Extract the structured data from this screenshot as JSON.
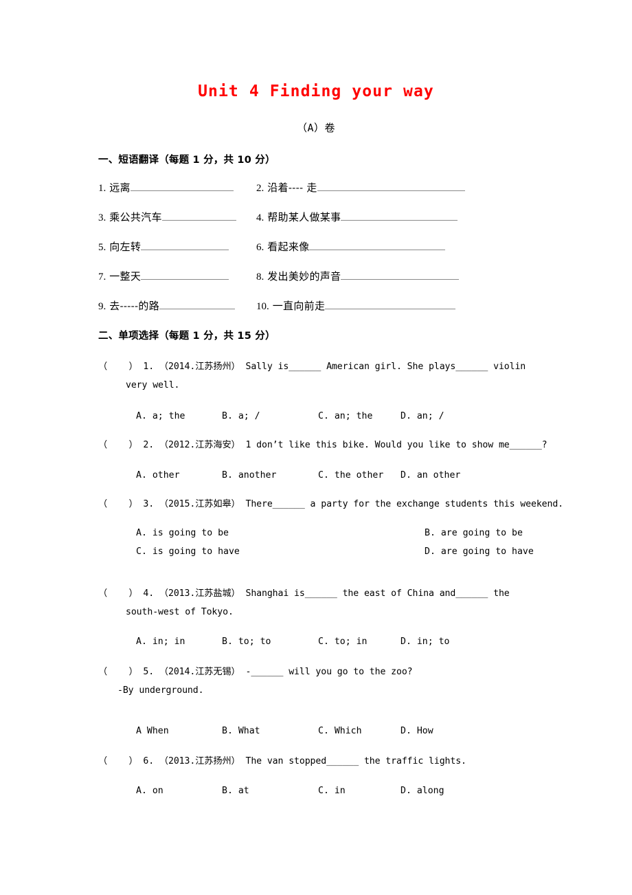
{
  "document": {
    "title": "Unit 4 Finding your way",
    "subtitle": "（A）卷"
  },
  "sections": [
    {
      "heading": "一、短语翻译（每题 1 分，共 10 分）",
      "type": "translation",
      "items": [
        {
          "num": "1.",
          "zh": "远离",
          "blank_width": 150
        },
        {
          "num": "2.",
          "zh": "沿着---- 走",
          "blank_width": 215
        },
        {
          "num": "3.",
          "zh": "乘公共汽车",
          "blank_width": 108
        },
        {
          "num": "4.",
          "zh": "帮助某人做某事",
          "blank_width": 170
        },
        {
          "num": "5.",
          "zh": "向左转",
          "blank_width": 128
        },
        {
          "num": "6.",
          "zh": "看起来像",
          "blank_width": 198
        },
        {
          "num": "7.",
          "zh": "一整天",
          "blank_width": 128
        },
        {
          "num": "8.",
          "zh": "发出美妙的声音",
          "blank_width": 172
        },
        {
          "num": "9.",
          "zh": "去-----的路",
          "blank_width": 110
        },
        {
          "num": "10.",
          "zh": "一直向前走",
          "blank_width": 190
        }
      ]
    },
    {
      "heading": "二、单项选择（每题 1 分，共 15 分）",
      "type": "multiple_choice",
      "questions": [
        {
          "marker": "（    ）",
          "num": "1.",
          "source": "（2014.江苏扬州）",
          "line1": "Sally is______ American girl. She plays______ violin",
          "line2": "very well.",
          "options": [
            "A. a; the",
            "B. a; /",
            "C. an; the",
            "D. an; /"
          ],
          "layout": "four-across"
        },
        {
          "marker": "（    ）",
          "num": "2.",
          "source": "（2012.江苏海安）",
          "line1": "1 don’t like this bike. Would you like to show me______?",
          "line2": "",
          "options": [
            "A. other",
            "B. another",
            "C. the other",
            "D. an other"
          ],
          "layout": "four-across"
        },
        {
          "marker": "（    ）",
          "num": "3.",
          "source": "（2015.江苏如皋）",
          "line1": "There______ a party for the exchange students this weekend.",
          "line2": "",
          "options": [
            "A. is going to be",
            "B. are going to be",
            "C. is going to have",
            "D. are going to have"
          ],
          "layout": "two-across"
        },
        {
          "marker": "（    ）",
          "num": "4.",
          "source": "（2013.江苏盐城）",
          "line1": "Shanghai is______ the east of China and______ the",
          "line2": "south-west of Tokyo.",
          "options": [
            "A. in; in",
            "B. to; to",
            "C. to; in",
            "D. in; to"
          ],
          "layout": "four-across"
        },
        {
          "marker": "（    ）",
          "num": "5.",
          "source": "（2014.江苏无锡）",
          "line1": "-______ will you go to the zoo?",
          "answer_line": "-By underground.",
          "options": [
            "A When",
            "B. What",
            "C. Which",
            "D. How"
          ],
          "layout": "four-across"
        },
        {
          "marker": "（    ）",
          "num": "6.",
          "source": "（2013.江苏扬州）",
          "line1": "The van stopped______ the traffic lights.",
          "line2": "",
          "options": [
            "A. on",
            "B. at",
            "C. in",
            "D. along"
          ],
          "layout": "four-across"
        }
      ]
    }
  ],
  "colors": {
    "title_red": "#ff0000",
    "body_black": "#000000",
    "rule_gray": "#8a8a8a"
  }
}
